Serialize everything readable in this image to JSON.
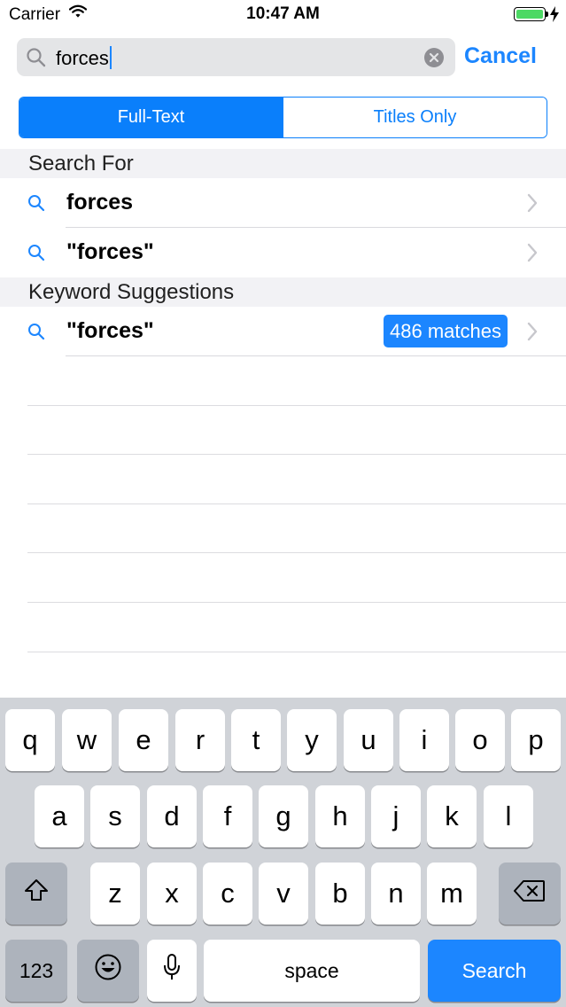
{
  "status": {
    "carrier": "Carrier",
    "time": "10:47 AM"
  },
  "search": {
    "value": "forces",
    "cancel_label": "Cancel"
  },
  "segments": [
    {
      "label": "Full-Text",
      "selected": true
    },
    {
      "label": "Titles Only",
      "selected": false
    }
  ],
  "sections": {
    "search_for": {
      "header": "Search For",
      "items": [
        {
          "text": "forces"
        },
        {
          "text": "\"forces\""
        }
      ]
    },
    "keyword_suggestions": {
      "header": "Keyword Suggestions",
      "items": [
        {
          "text": "\"forces\"",
          "badge": "486 matches"
        }
      ]
    }
  },
  "keyboard": {
    "row1": [
      "q",
      "w",
      "e",
      "r",
      "t",
      "y",
      "u",
      "i",
      "o",
      "p"
    ],
    "row2": [
      "a",
      "s",
      "d",
      "f",
      "g",
      "h",
      "j",
      "k",
      "l"
    ],
    "row3": [
      "z",
      "x",
      "c",
      "v",
      "b",
      "n",
      "m"
    ],
    "numbers_label": "123",
    "space_label": "space",
    "search_label": "Search"
  },
  "colors": {
    "accent": "#1c86ff",
    "segment_blue": "#0a7ffb",
    "keyboard_bg": "#d0d3d8"
  }
}
